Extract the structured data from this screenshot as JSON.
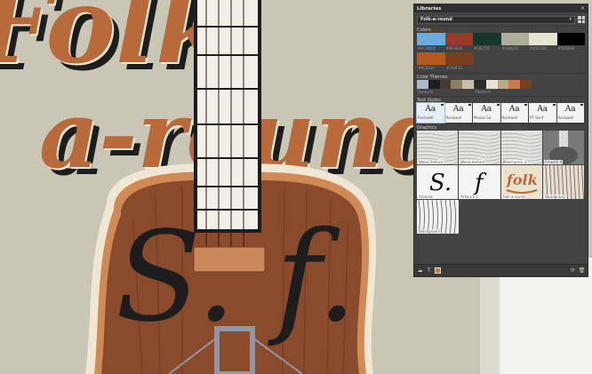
{
  "artwork": {
    "title_line1": "Folk",
    "title_line2": "a-round",
    "body_letters": "S. f.",
    "colors": {
      "background": "#c9c6b6",
      "title_fill": "#b86a3a",
      "title_shadow": "#1d1d1d",
      "guitar_body": "#8a4a2c",
      "guitar_rim": "#d08a55",
      "neck": "#f1efe6",
      "bridge": "#c9875a"
    }
  },
  "libraries_panel": {
    "title": "Libraries",
    "close_glyph": "✕",
    "library_name": "Folk-a-round",
    "chevron_glyph": "▾",
    "colors_header": "Colors",
    "colors": [
      {
        "hex": "#6CADDF",
        "label": "#6CADDF"
      },
      {
        "hex": "#993929",
        "label": "#993929"
      },
      {
        "hex": "#18372C",
        "label": "#18372C"
      },
      {
        "hex": "#ADAE97",
        "label": "#ADAE97"
      },
      {
        "hex": "#E5E5D1",
        "label": "#E5E5D1"
      },
      {
        "hex": "#000000",
        "label": "#000000"
      },
      {
        "hex": "#B55A1F",
        "label": "#B55A1F"
      },
      {
        "hex": "#7A3F21",
        "label": "#7A3F21"
      }
    ],
    "themes_header": "Color Themes",
    "themes": [
      {
        "label": "Theme 9",
        "colors": [
          "#a8b8c9",
          "#1d1d1d",
          "#4a3a2e",
          "#8e7f67",
          "#c9c1a6"
        ]
      },
      {
        "label": "Theme 9",
        "colors": [
          "#2a2a2a",
          "#e8e2d0",
          "#b9a98a",
          "#c97a45",
          "#7a3f21"
        ]
      }
    ],
    "text_styles_header": "Text Styles",
    "text_styles": [
      {
        "glyph": "Aa",
        "label": "Rockwell",
        "selected": true
      },
      {
        "glyph": "Aa",
        "label": "Rockwell",
        "selected": false
      },
      {
        "glyph": "Aa",
        "label": "Museo Sa",
        "selected": false
      },
      {
        "glyph": "Aa",
        "label": "Rockwell",
        "selected": false
      },
      {
        "glyph": "Aa",
        "label": "PT Serif",
        "selected": false
      },
      {
        "glyph": "Aa",
        "label": "Rockwell",
        "selected": false
      }
    ],
    "graphics_header": "Graphics",
    "graphics": [
      {
        "label": "Wood Texture",
        "kind": "wood-light"
      },
      {
        "label": "Wood texture",
        "kind": "wood-light"
      },
      {
        "label": "Wood grain 4",
        "kind": "wood-light"
      },
      {
        "label": "Artwork 4",
        "kind": "guitar"
      },
      {
        "label": "Artwork",
        "kind": "s-letter"
      },
      {
        "label": "Artwork 2",
        "kind": "f-letter"
      },
      {
        "label": "Folk-a-round",
        "kind": "folk-logo",
        "logo_text": "folk"
      },
      {
        "label": "Woodgrain2",
        "kind": "wood-dark"
      },
      {
        "label": "Woodgrain3",
        "kind": "wood-bw"
      }
    ],
    "footer_icons": [
      "cc-icon",
      "text-icon",
      "color-fill-icon"
    ],
    "footer_right_icons": [
      "sync-icon",
      "trash-icon"
    ]
  }
}
